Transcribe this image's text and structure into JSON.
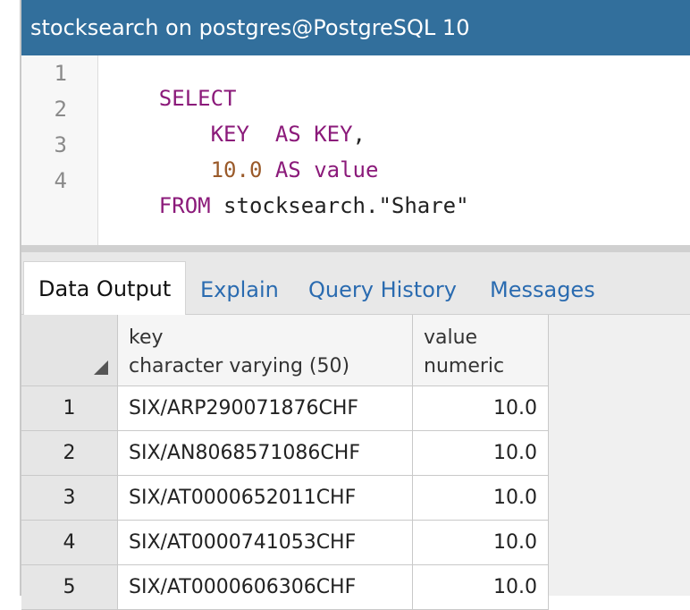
{
  "window": {
    "title": "stocksearch on postgres@PostgreSQL 10"
  },
  "editor": {
    "line_numbers": [
      "1",
      "2",
      "3",
      "4"
    ],
    "lines": [
      {
        "tokens": [
          {
            "t": "SELECT",
            "k": "kw"
          }
        ]
      },
      {
        "tokens": [
          {
            "t": "    KEY  ",
            "k": "kw"
          },
          {
            "t": "AS KEY",
            "k": "kw"
          },
          {
            "t": ",",
            "k": "plain"
          }
        ]
      },
      {
        "tokens": [
          {
            "t": "    10.0 ",
            "k": "num"
          },
          {
            "t": "AS value",
            "k": "kw"
          }
        ]
      },
      {
        "tokens": [
          {
            "t": "FROM ",
            "k": "kw"
          },
          {
            "t": "stocksearch.\"Share\"",
            "k": "plain"
          }
        ]
      }
    ]
  },
  "tabs": [
    {
      "label": "Data Output",
      "active": true
    },
    {
      "label": "Explain",
      "active": false
    },
    {
      "label": "Query History",
      "active": false
    },
    {
      "label": "Messages",
      "active": false
    }
  ],
  "grid": {
    "columns": [
      {
        "name": "key",
        "type": "character varying (50)"
      },
      {
        "name": "value",
        "type": "numeric"
      }
    ],
    "rows": [
      {
        "num": "1",
        "key": "SIX/ARP290071876CHF",
        "value": "10.0"
      },
      {
        "num": "2",
        "key": "SIX/AN8068571086CHF",
        "value": "10.0"
      },
      {
        "num": "3",
        "key": "SIX/AT0000652011CHF",
        "value": "10.0"
      },
      {
        "num": "4",
        "key": "SIX/AT0000741053CHF",
        "value": "10.0"
      },
      {
        "num": "5",
        "key": "SIX/AT0000606306CHF",
        "value": "10.0"
      }
    ]
  },
  "colors": {
    "titlebar": "#326f9c",
    "keyword": "#8b1a7a",
    "number": "#9a5a2a",
    "tab_link": "#2a6bb0"
  }
}
